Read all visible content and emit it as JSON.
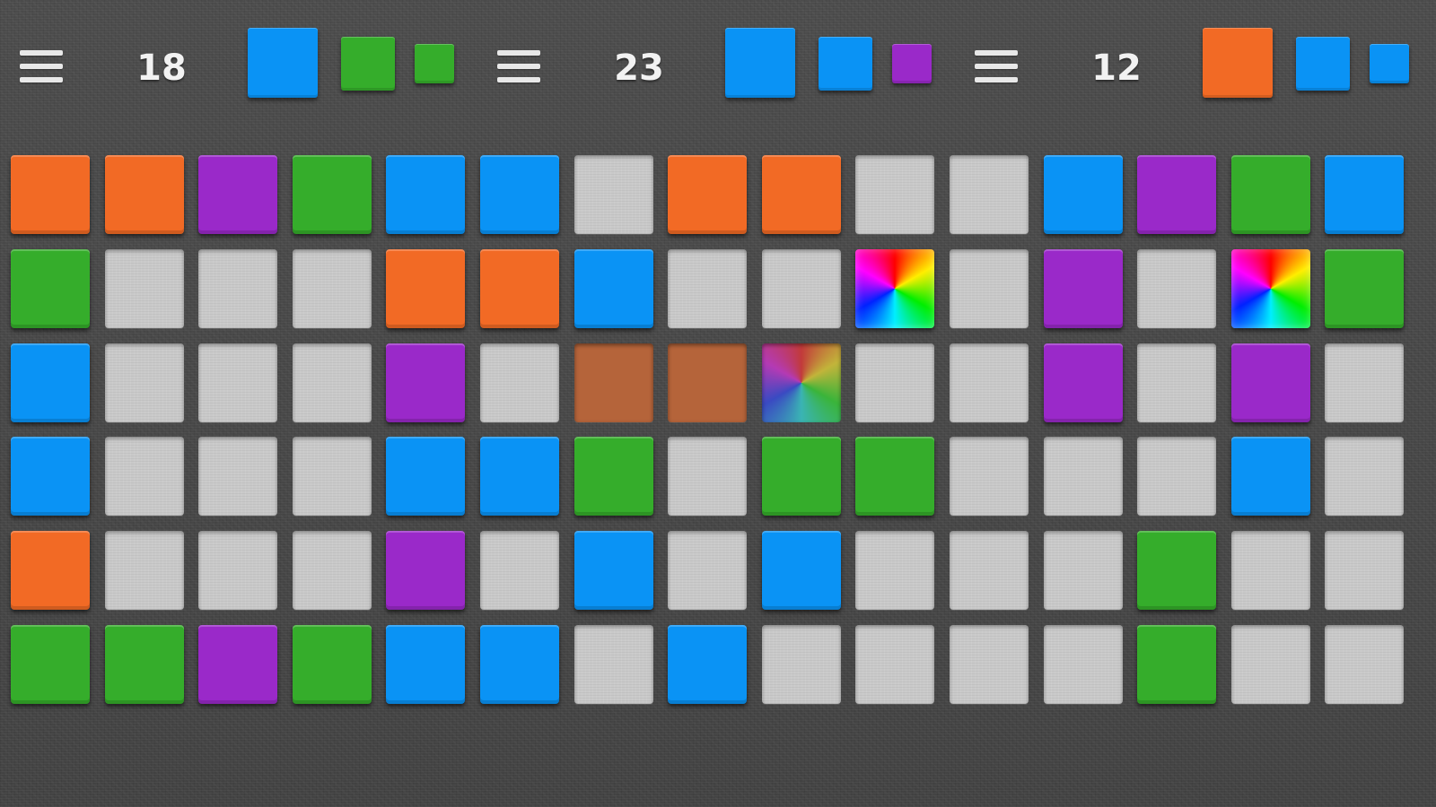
{
  "colors": {
    "orange": "#f26a25",
    "green": "#35ad2b",
    "purple": "#9a29c9",
    "blue": "#0a93f5",
    "empty": "#c9c9c9",
    "brown": "#b5643a"
  },
  "players": [
    {
      "menu_icon": "hamburger-menu-icon",
      "score": "18",
      "next_pieces": [
        "blue",
        "green",
        "green"
      ]
    },
    {
      "menu_icon": "hamburger-menu-icon",
      "score": "23",
      "next_pieces": [
        "blue",
        "blue",
        "purple"
      ]
    },
    {
      "menu_icon": "hamburger-menu-icon",
      "score": "12",
      "next_pieces": [
        "orange",
        "blue",
        "blue"
      ]
    }
  ],
  "board": {
    "columns": 15,
    "rows": [
      [
        "orange",
        "orange",
        "purple",
        "green",
        "blue",
        "blue",
        "empty",
        "orange",
        "orange",
        "empty",
        "empty",
        "blue",
        "purple",
        "green",
        "blue"
      ],
      [
        "green",
        "empty",
        "empty",
        "empty",
        "orange",
        "orange",
        "blue",
        "empty",
        "empty",
        "rainbow",
        "empty",
        "purple",
        "empty",
        "rainbow",
        "green"
      ],
      [
        "blue",
        "empty",
        "empty",
        "empty",
        "purple",
        "empty",
        "brown",
        "brown",
        "rainbow-dim",
        "empty",
        "empty",
        "purple",
        "empty",
        "purple",
        "empty"
      ],
      [
        "blue",
        "empty",
        "empty",
        "empty",
        "blue",
        "blue",
        "green",
        "empty",
        "green",
        "green",
        "empty",
        "empty",
        "empty",
        "blue",
        "empty"
      ],
      [
        "orange",
        "empty",
        "empty",
        "empty",
        "purple",
        "empty",
        "blue",
        "empty",
        "blue",
        "empty",
        "empty",
        "empty",
        "green",
        "empty",
        "empty"
      ],
      [
        "green",
        "green",
        "purple",
        "green",
        "blue",
        "blue",
        "empty",
        "blue",
        "empty",
        "empty",
        "empty",
        "empty",
        "green",
        "empty",
        "empty"
      ]
    ]
  }
}
